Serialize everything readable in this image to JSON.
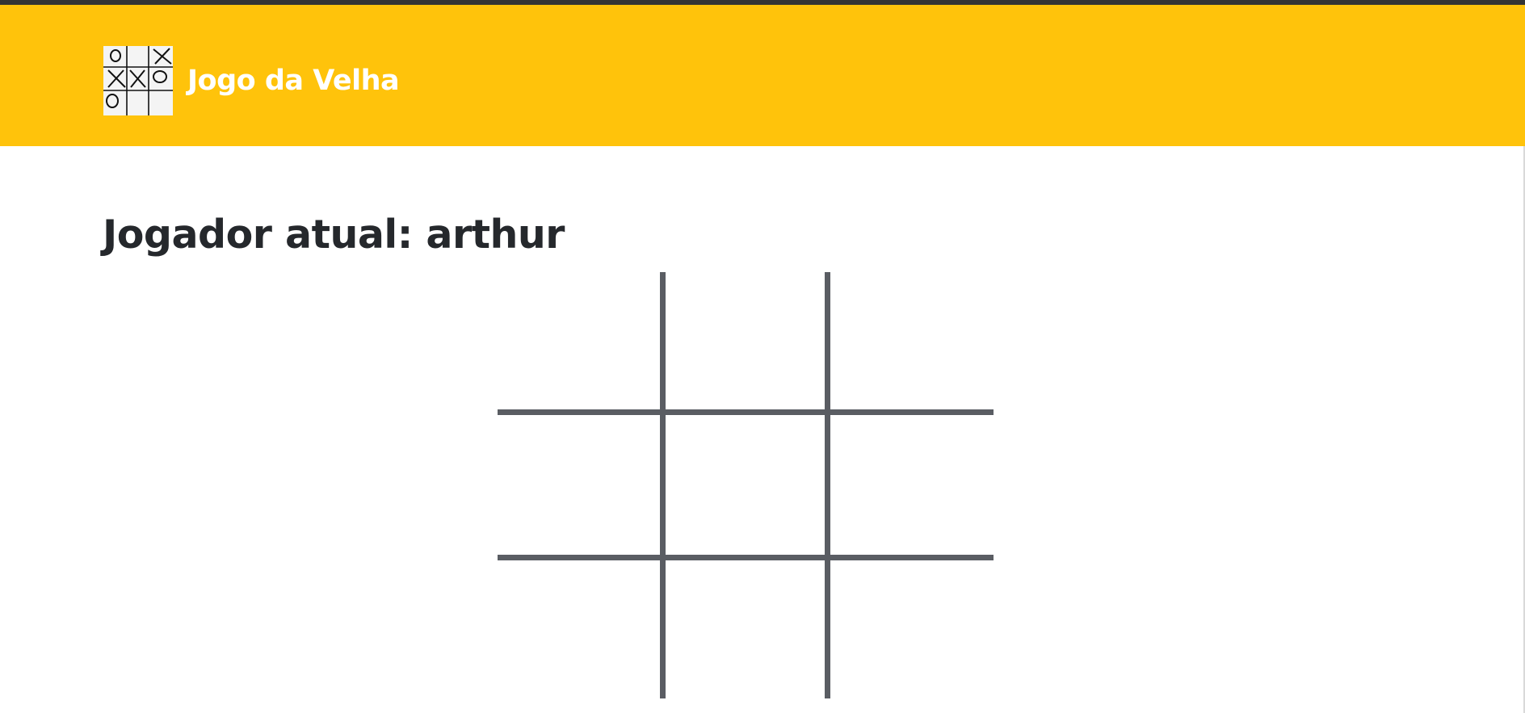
{
  "header": {
    "title": "Jogo da Velha",
    "logo_icon": "tic-tac-toe-logo-icon",
    "logo_marks": [
      "O",
      "",
      "X",
      "X",
      "X",
      "O",
      "O",
      "",
      ""
    ],
    "background": "#ffc30b",
    "title_color": "#ffffff"
  },
  "top_strip_color": "#343434",
  "game": {
    "status_text": "Jogador atual: arthur",
    "board": {
      "cells": [
        "",
        "",
        "",
        "",
        "",
        "",
        "",
        "",
        ""
      ],
      "line_color": "#5a5d63"
    }
  }
}
